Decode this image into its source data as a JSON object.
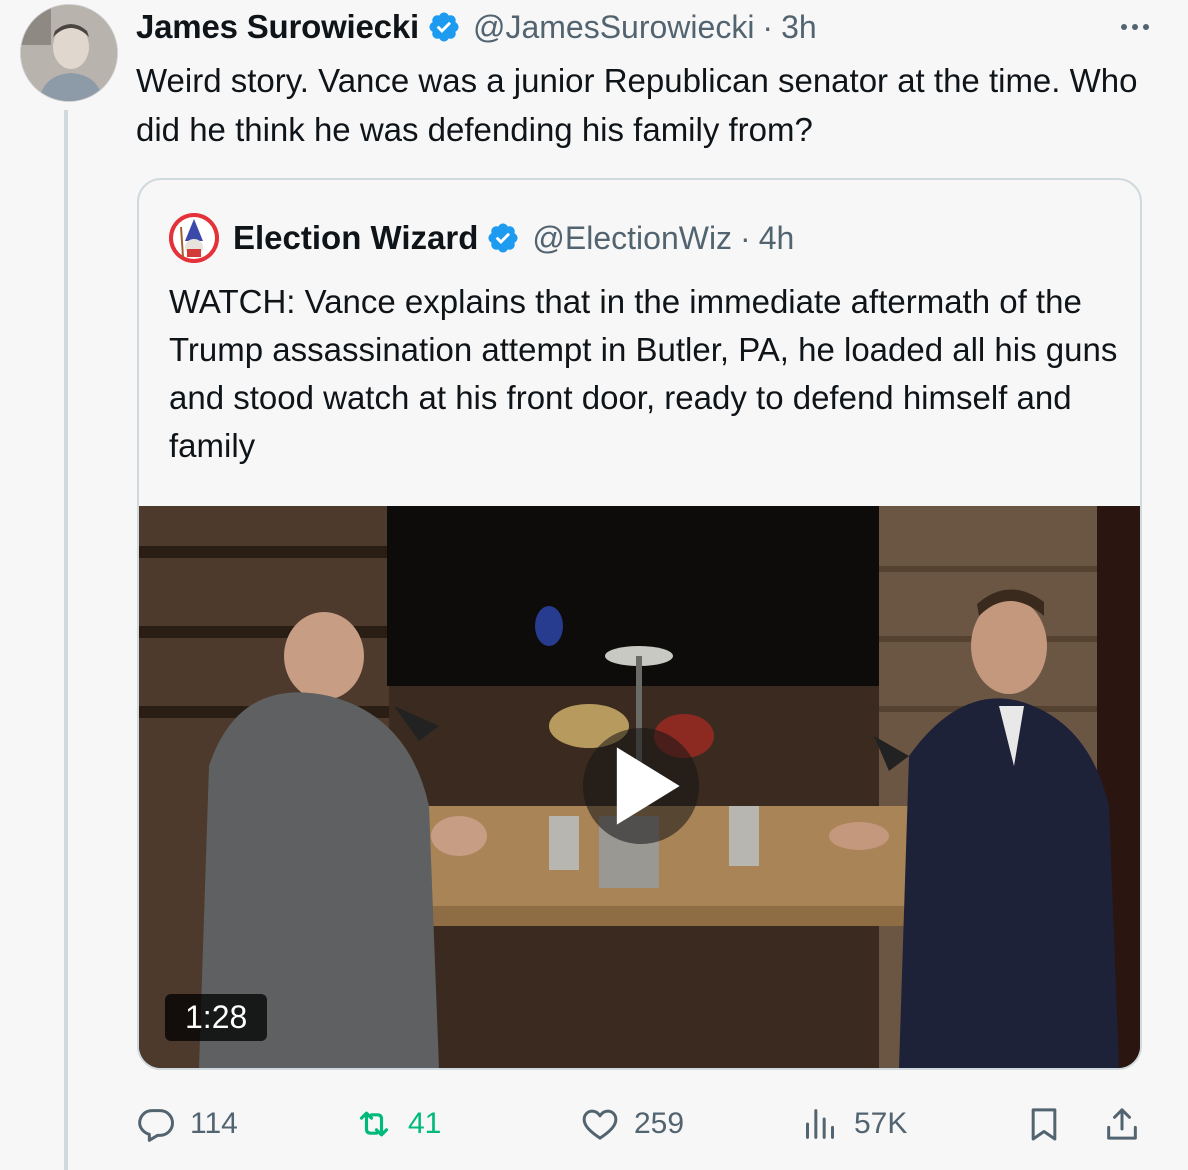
{
  "tweet": {
    "author_name": "James Surowiecki",
    "handle": "@JamesSurowiecki",
    "separator": "·",
    "time": "3h",
    "text": "Weird story. Vance was a junior Republican senator at the time. Who did he think he was defending his family from?"
  },
  "quoted_tweet": {
    "author_name": "Election Wizard",
    "handle": "@ElectionWiz",
    "separator": "·",
    "time": "4h",
    "text": "WATCH:  Vance explains that in the immediate aftermath of the Trump assassination attempt in Butler, PA, he loaded all his guns and stood watch at his front door, ready to defend himself and family",
    "video": {
      "duration": "1:28"
    }
  },
  "actions": {
    "replies": "114",
    "retweets": "41",
    "likes": "259",
    "views": "57K"
  },
  "colors": {
    "verified": "#1d9bf0",
    "retweet_active": "#00ba7c",
    "secondary_text": "#536471",
    "border": "#cfd9de"
  },
  "icons": [
    "verified-badge-icon",
    "more-options-icon",
    "reply-icon",
    "retweet-icon",
    "like-icon",
    "views-icon",
    "bookmark-icon",
    "share-icon",
    "play-icon"
  ]
}
